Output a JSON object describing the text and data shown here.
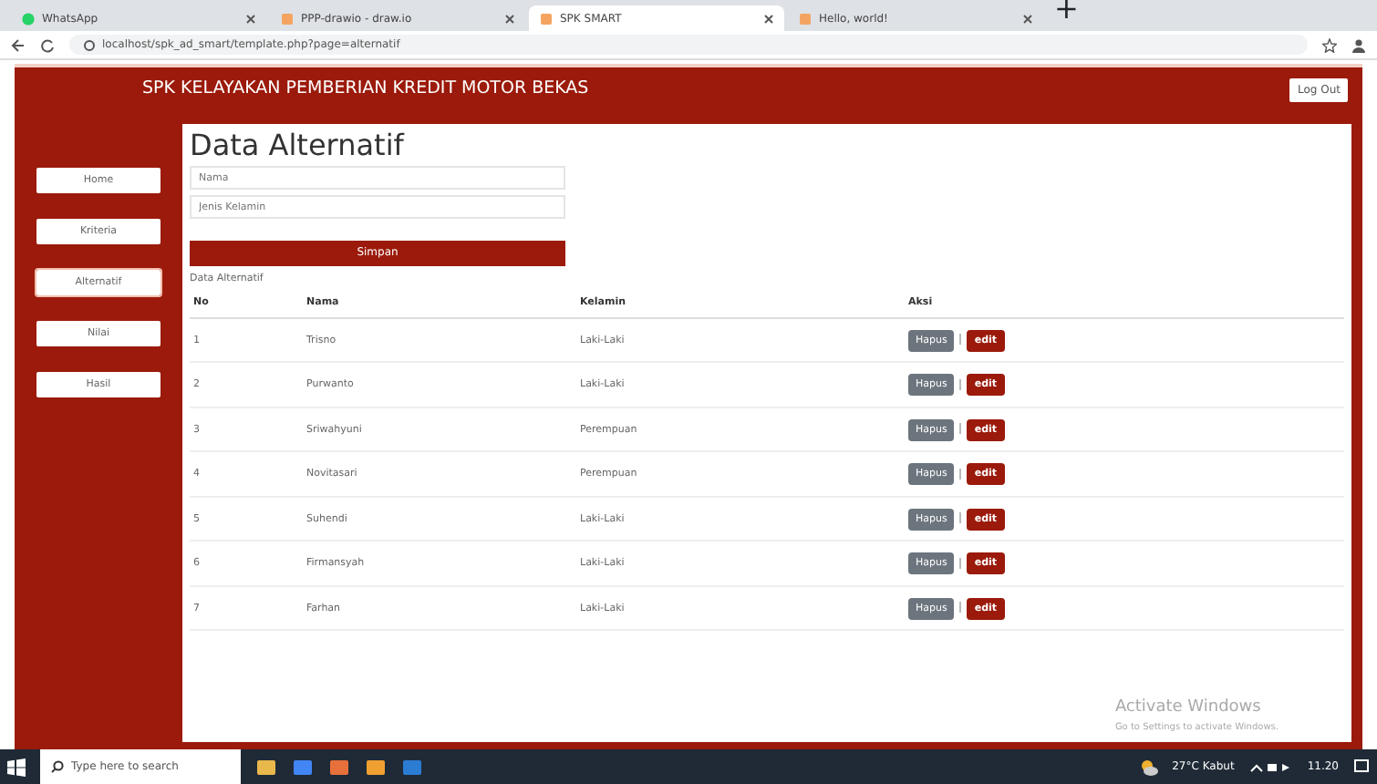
{
  "browser": {
    "tabs": [
      {
        "title": "WhatsApp",
        "selected": false
      },
      {
        "title": "PPP-drawio - draw.io",
        "selected": false
      },
      {
        "title": "SPK SMART",
        "selected": true
      },
      {
        "title": "Hello, world!",
        "selected": false
      }
    ],
    "new_tab": "+",
    "url": "localhost/spk_ad_smart/template.php?page=alternatif"
  },
  "header": {
    "title": "SPK KELAYAKAN PEMBERIAN KREDIT MOTOR BEKAS",
    "logout": "Log Out"
  },
  "sidebar": {
    "items": [
      {
        "label": "Home",
        "selected": false
      },
      {
        "label": "Kriteria",
        "selected": false
      },
      {
        "label": "Alternatif",
        "selected": true
      },
      {
        "label": "Nilai",
        "selected": false
      },
      {
        "label": "Hasil",
        "selected": false
      }
    ]
  },
  "page_title": "Data Alternatif",
  "form": {
    "fields": [
      {
        "placeholder": "Nama"
      },
      {
        "placeholder": "Jenis Kelamin"
      }
    ],
    "submit": "Simpan"
  },
  "table": {
    "caption": "Data Alternatif",
    "columns": [
      "No",
      "Nama",
      "Kelamin",
      "Aksi"
    ],
    "rows": [
      {
        "no": "1",
        "nama": "Trisno",
        "kelamin": "Laki-Laki",
        "actions": [
          "Hapus",
          "edit"
        ]
      },
      {
        "no": "2",
        "nama": "Purwanto",
        "kelamin": "Laki-Laki",
        "actions": [
          "Hapus",
          "edit"
        ]
      },
      {
        "no": "3",
        "nama": "Sriwahyuni",
        "kelamin": "Perempuan",
        "actions": [
          "Hapus",
          "edit"
        ]
      },
      {
        "no": "4",
        "nama": "Novitasari",
        "kelamin": "Perempuan",
        "actions": [
          "Hapus",
          "edit"
        ]
      },
      {
        "no": "5",
        "nama": "Suhendi",
        "kelamin": "Laki-Laki",
        "actions": [
          "Hapus",
          "edit"
        ]
      },
      {
        "no": "6",
        "nama": "Firmansyah",
        "kelamin": "Laki-Laki",
        "actions": [
          "Hapus",
          "edit"
        ]
      },
      {
        "no": "7",
        "nama": "Farhan",
        "kelamin": "Laki-Laki",
        "actions": [
          "Hapus",
          "edit"
        ]
      }
    ]
  },
  "activation": {
    "title": "Activate Windows",
    "hint": "Go to Settings to activate Windows."
  },
  "taskbar": {
    "search_placeholder": "Type here to search",
    "weather": "27°C Kabut",
    "time": "11.20"
  }
}
